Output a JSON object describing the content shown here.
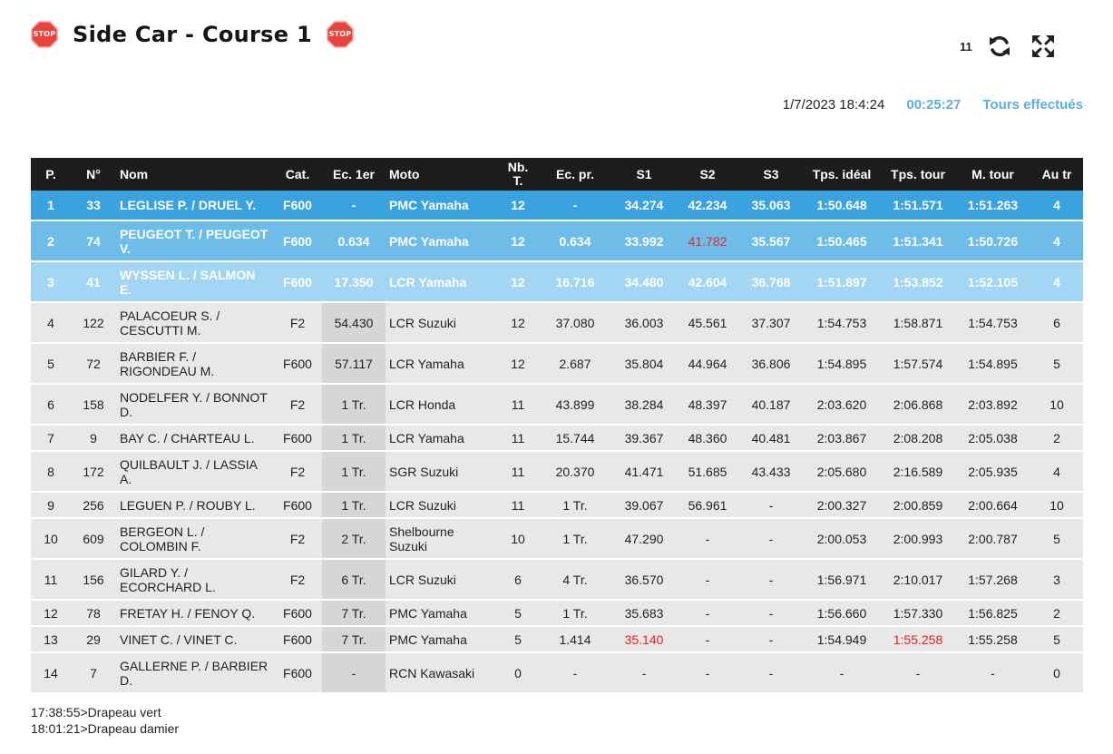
{
  "header": {
    "title": "Side Car - Course 1",
    "stop_label": "STOP",
    "lap_count": "11"
  },
  "info": {
    "datetime": "1/7/2023 18:4:24",
    "elapsed": "00:25:27",
    "laps_link": "Tours effectués"
  },
  "table": {
    "columns": [
      "P.",
      "N°",
      "Nom",
      "Cat.",
      "Ec. 1er",
      "Moto",
      "Nb. T.",
      "Ec. pr.",
      "S1",
      "S2",
      "S3",
      "Tps. idéal",
      "Tps. tour",
      "M. tour",
      "Au tr"
    ],
    "rows": [
      [
        "1",
        "33",
        "LEGLISE P. / DRUEL Y.",
        "F600",
        "-",
        "PMC Yamaha",
        "12",
        "-",
        "34.274",
        "42.234",
        "35.063",
        "1:50.648",
        "1:51.571",
        "1:51.263",
        "4"
      ],
      [
        "2",
        "74",
        "PEUGEOT T. / PEUGEOT V.",
        "F600",
        "0.634",
        "PMC Yamaha",
        "12",
        "0.634",
        "33.992",
        "41.782",
        "35.567",
        "1:50.465",
        "1:51.341",
        "1:50.726",
        "4"
      ],
      [
        "3",
        "41",
        "WYSSEN L. / SALMON E.",
        "F600",
        "17.350",
        "LCR Yamaha",
        "12",
        "16.716",
        "34.480",
        "42.604",
        "36.768",
        "1:51.897",
        "1:53.852",
        "1:52.105",
        "4"
      ],
      [
        "4",
        "122",
        "PALACOEUR S. / CESCUTTI M.",
        "F2",
        "54.430",
        "LCR Suzuki",
        "12",
        "37.080",
        "36.003",
        "45.561",
        "37.307",
        "1:54.753",
        "1:58.871",
        "1:54.753",
        "6"
      ],
      [
        "5",
        "72",
        "BARBIER F. / RIGONDEAU M.",
        "F600",
        "57.117",
        "LCR Yamaha",
        "12",
        "2.687",
        "35.804",
        "44.964",
        "36.806",
        "1:54.895",
        "1:57.574",
        "1:54.895",
        "5"
      ],
      [
        "6",
        "158",
        "NODELFER Y. / BONNOT D.",
        "F2",
        "1 Tr.",
        "LCR Honda",
        "11",
        "43.899",
        "38.284",
        "48.397",
        "40.187",
        "2:03.620",
        "2:06.868",
        "2:03.892",
        "10"
      ],
      [
        "7",
        "9",
        "BAY C. / CHARTEAU L.",
        "F600",
        "1 Tr.",
        "LCR Yamaha",
        "11",
        "15.744",
        "39.367",
        "48.360",
        "40.481",
        "2:03.867",
        "2:08.208",
        "2:05.038",
        "2"
      ],
      [
        "8",
        "172",
        "QUILBAULT J. / LASSIA A.",
        "F2",
        "1 Tr.",
        "SGR Suzuki",
        "11",
        "20.370",
        "41.471",
        "51.685",
        "43.433",
        "2:05.680",
        "2:16.589",
        "2:05.935",
        "4"
      ],
      [
        "9",
        "256",
        "LEGUEN P. / ROUBY L.",
        "F600",
        "1 Tr.",
        "LCR Suzuki",
        "11",
        "1 Tr.",
        "39.067",
        "56.961",
        "-",
        "2:00.327",
        "2:00.859",
        "2:00.664",
        "10"
      ],
      [
        "10",
        "609",
        "BERGEON L. / COLOMBIN F.",
        "F2",
        "2 Tr.",
        "Shelbourne Suzuki",
        "10",
        "1 Tr.",
        "47.290",
        "-",
        "-",
        "2:00.053",
        "2:00.993",
        "2:00.787",
        "5"
      ],
      [
        "11",
        "156",
        "GILARD Y. / ECORCHARD L.",
        "F2",
        "6 Tr.",
        "LCR Suzuki",
        "6",
        "4 Tr.",
        "36.570",
        "-",
        "-",
        "1:56.971",
        "2:10.017",
        "1:57.268",
        "3"
      ],
      [
        "12",
        "78",
        "FRETAY H. / FENOY Q.",
        "F600",
        "7 Tr.",
        "PMC Yamaha",
        "5",
        "1 Tr.",
        "35.683",
        "-",
        "-",
        "1:56.660",
        "1:57.330",
        "1:56.825",
        "2"
      ],
      [
        "13",
        "29",
        "VINET C. / VINET C.",
        "F600",
        "7 Tr.",
        "PMC Yamaha",
        "5",
        "1.414",
        "35.140",
        "-",
        "-",
        "1:54.949",
        "1:55.258",
        "1:55.258",
        "5"
      ],
      [
        "14",
        "7",
        "GALLERNE P. / BARBIER D.",
        "F600",
        "-",
        "RCN Kawasaki",
        "0",
        "-",
        "-",
        "-",
        "-",
        "-",
        "-",
        "-",
        "0"
      ]
    ]
  },
  "log": [
    "17:38:55>Drapeau vert",
    "18:01:21>Drapeau damier"
  ],
  "colors": {
    "header_bg": "#1d1d1d",
    "leader_row": "#3aa3df",
    "second_row": "#6dbde8",
    "third_row": "#a3d6f2",
    "row_bg": "#e8e8e8",
    "accent": "#5aaee2",
    "stop_red": "#e8433c",
    "best_time": "#e02020"
  },
  "icons": {
    "stop": "stop-sign-icon",
    "refresh": "refresh-icon",
    "fullscreen": "fullscreen-icon"
  }
}
